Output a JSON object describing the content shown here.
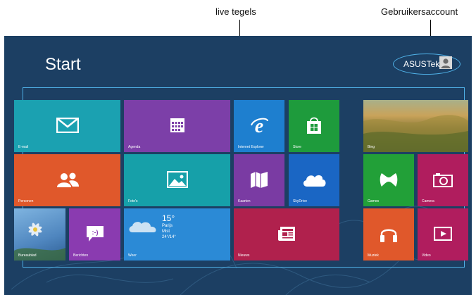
{
  "callouts": {
    "live_tiles": "live tegels",
    "user_account": "Gebruikersaccount"
  },
  "start": {
    "title": "Start",
    "username": "ASUSTek"
  },
  "tiles": {
    "email": {
      "label": "E-mail",
      "icon": "mail-icon",
      "color": "#1ba1b1"
    },
    "agenda": {
      "label": "Agenda",
      "icon": "calendar-icon",
      "color": "#7c3fa8"
    },
    "ie": {
      "label": "Internet Explorer",
      "icon": "internet-explorer-icon",
      "color": "#1e7fcf"
    },
    "store": {
      "label": "Store",
      "icon": "store-icon",
      "color": "#1e9b3c"
    },
    "bing": {
      "label": "Bing",
      "icon": "landscape-photo"
    },
    "personen": {
      "label": "Personen",
      "icon": "people-icon",
      "color": "#e0582b"
    },
    "fotos": {
      "label": "Foto's",
      "icon": "photo-icon",
      "color": "#16a0a9"
    },
    "kaarten": {
      "label": "Kaarten",
      "icon": "maps-icon",
      "color": "#7a3ba3"
    },
    "skydrive": {
      "label": "SkyDrive",
      "icon": "cloud-icon",
      "color": "#1a66c4"
    },
    "games": {
      "label": "Games",
      "icon": "gamepad-icon",
      "color": "#22a038"
    },
    "camera": {
      "label": "Camera",
      "icon": "camera-icon",
      "color": "#b01d5e"
    },
    "bureaublad": {
      "label": "Bureaublad",
      "icon": "desktop-flower-photo"
    },
    "berichten": {
      "label": "Berichten",
      "icon": "messaging-icon",
      "color": "#8a3bb0"
    },
    "weer": {
      "label": "Weer",
      "icon": "weather-cloud-icon",
      "color": "#2b8ad6",
      "temp": "15°",
      "city": "Parijs",
      "condition": "Mist",
      "range": "24°/14°"
    },
    "nieuws": {
      "label": "Nieuws",
      "icon": "news-icon",
      "color": "#b0214d"
    },
    "muziek": {
      "label": "Muziek",
      "icon": "headphones-icon",
      "color": "#e0582b"
    },
    "video": {
      "label": "Video",
      "icon": "video-icon",
      "color": "#b01d5e"
    }
  }
}
